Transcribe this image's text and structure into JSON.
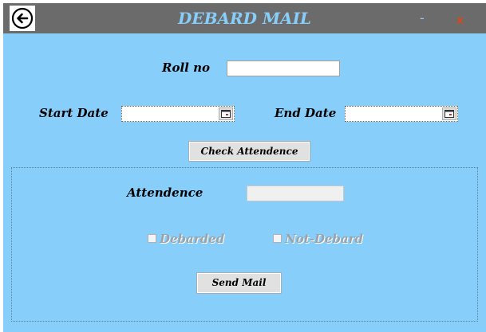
{
  "window": {
    "title": "DEBARD MAIL",
    "minimize_label": "-",
    "close_label": "x"
  },
  "form": {
    "roll_no_label": "Roll no",
    "roll_no_value": "",
    "start_date_label": "Start Date",
    "start_date_value": "",
    "end_date_label": "End Date",
    "end_date_value": "",
    "check_button_label": "Check Attendence"
  },
  "result": {
    "attendence_label": "Attendence",
    "attendence_value": "",
    "debarded_label": "Debarded",
    "debarded_checked": false,
    "not_debarded_label": "Not-Debard",
    "not_debarded_checked": false,
    "send_button_label": "Send Mail"
  },
  "colors": {
    "background": "#87cefa",
    "titlebar": "#6b6b6b",
    "title_text": "#87cefa",
    "close": "#ff3b00"
  },
  "icons": {
    "back": "back-arrow-icon",
    "calendar": "calendar-icon"
  }
}
